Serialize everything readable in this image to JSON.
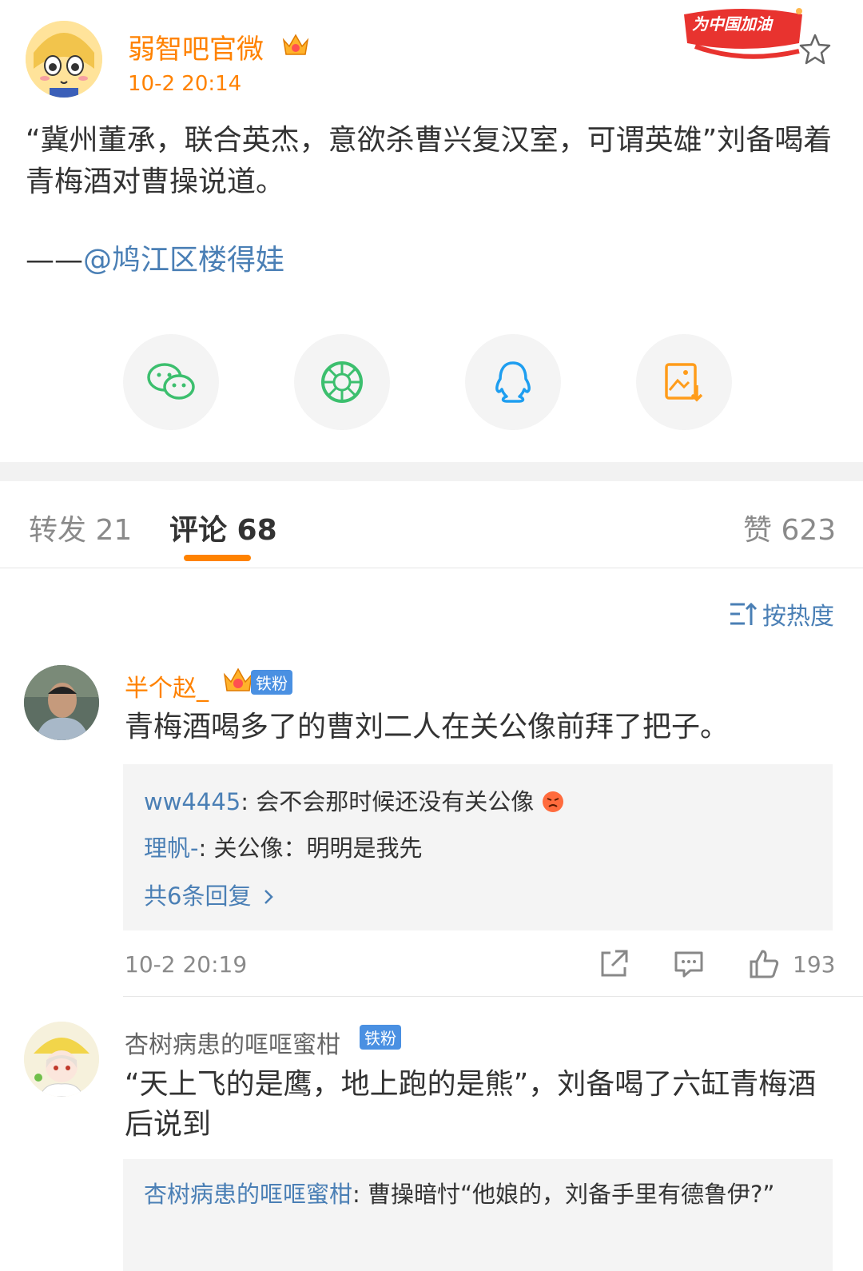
{
  "post": {
    "username": "弱智吧官微",
    "time": "10-2 20:14",
    "promo_label": "为中国加油",
    "text": "“冀州董承，联合英杰，意欲杀曹兴复汉室，可谓英雄”刘备喝着青梅酒对曹操说道。",
    "signature_prefix": "——",
    "signature_mention": "@鸠江区楼得娃"
  },
  "tabs": {
    "repost": "转发 21",
    "comment": "评论 68",
    "like": "赞 623"
  },
  "sort_label": "按热度",
  "comments": [
    {
      "name": "半个赵_",
      "badge": "铁粉",
      "text": "青梅酒喝多了的曹刘二人在关公像前拜了把子。",
      "replies": [
        {
          "name": "ww4445",
          "text": ": 会不会那时候还没有关公像"
        },
        {
          "name": "理帆-",
          "text": ": 关公像：明明是我先"
        }
      ],
      "more_replies": "共6条回复",
      "time": "10-2 20:19",
      "likes": "193"
    },
    {
      "name": "杏树病患的哐哐蜜柑",
      "badge": "铁粉",
      "text": "“天上飞的是鹰，地上跑的是熊”，刘备喝了六缸青梅酒后说到",
      "replies": [
        {
          "name": "杏树病患的哐哐蜜柑",
          "text": ": 曹操暗忖“他娘的，刘备手里有德鲁伊?”"
        }
      ]
    }
  ],
  "colors": {
    "accent": "#ff8200",
    "link": "#4a7fb5",
    "muted": "#8a8a8a"
  },
  "icons": [
    "star-icon",
    "wechat-icon",
    "moments-icon",
    "qq-icon",
    "save-image-icon",
    "sort-icon",
    "share-icon",
    "comment-icon",
    "like-icon",
    "chevron-right-icon",
    "angry-emoji-icon",
    "crown-icon"
  ]
}
